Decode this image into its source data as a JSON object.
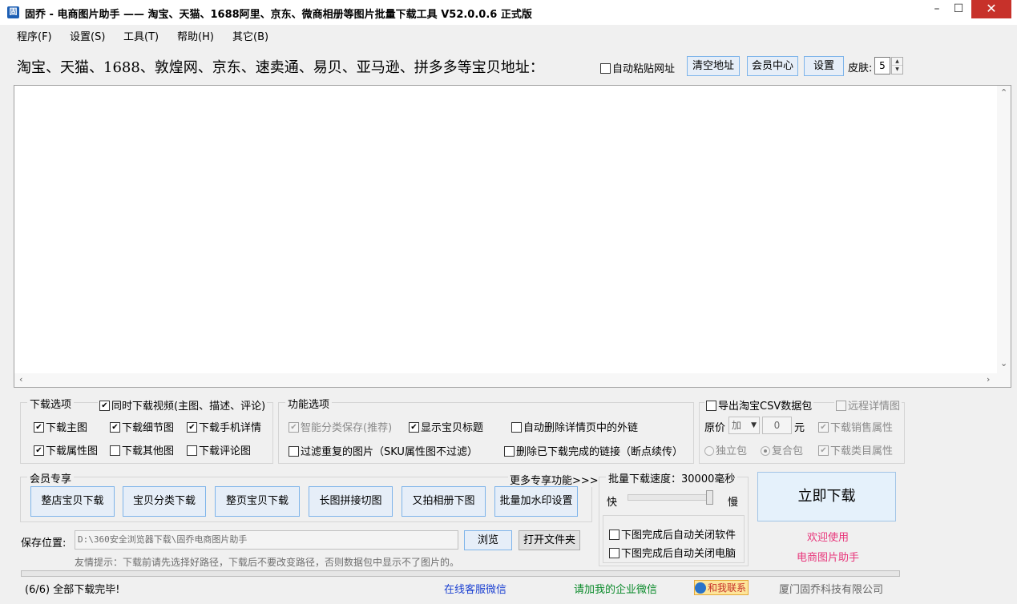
{
  "window": {
    "icon_glyph": "固",
    "title": "固乔 - 电商图片助手 —— 淘宝、天猫、1688阿里、京东、微商相册等图片批量下载工具 V52.0.0.6 正式版",
    "minimize": "–",
    "maximize": "☐",
    "close": "✕"
  },
  "menu": {
    "items": [
      "程序(F)",
      "设置(S)",
      "工具(T)",
      "帮助(H)",
      "其它(B)"
    ]
  },
  "url_row": {
    "label": "淘宝、天猫、1688、敦煌网、京东、速卖通、易贝、亚马逊、拼多多等宝贝地址：",
    "auto_paste": "自动粘贴网址",
    "clear_button": "清空地址",
    "member_button": "会员中心",
    "settings_button": "设置",
    "skin_label": "皮肤:",
    "skin_value": "5"
  },
  "textarea": {
    "value": ""
  },
  "download_options": {
    "title": "下载选项",
    "video": "同时下载视频(主图、描述、评论)",
    "main": "下载主图",
    "detail": "下载细节图",
    "mobile": "下载手机详情",
    "attr": "下载属性图",
    "other": "下载其他图",
    "review": "下载评论图"
  },
  "function_options": {
    "title": "功能选项",
    "smart_save": "智能分类保存(推荐)",
    "show_title": "显示宝贝标题",
    "remove_links": "自动删除详情页中的外链",
    "filter_dup": "过滤重复的图片（SKU属性图不过滤）",
    "delete_done": "删除已下载完成的链接（断点续传）"
  },
  "csv_options": {
    "export_csv": "导出淘宝CSV数据包",
    "remote_detail": "远程详情图",
    "price_label": "原价",
    "price_op": "加",
    "price_value": "0",
    "price_unit": "元",
    "sales_attr": "下载销售属性",
    "single_pack": "独立包",
    "combo_pack": "复合包",
    "category_attr": "下载类目属性"
  },
  "member": {
    "title": "会员专享",
    "more": "更多专享功能>>>",
    "buttons": [
      "整店宝贝下载",
      "宝贝分类下载",
      "整页宝贝下载",
      "长图拼接切图",
      "又拍相册下图",
      "批量加水印设置"
    ]
  },
  "speed": {
    "title": "批量下载速度：30000毫秒",
    "fast": "快",
    "slow": "慢",
    "level": 1.0,
    "close_app": "下图完成后自动关闭软件",
    "close_pc": "下图完成后自动关闭电脑"
  },
  "download_now": "立即下载",
  "welcome_line1": "欢迎使用",
  "welcome_line2": "电商图片助手",
  "save": {
    "label": "保存位置:",
    "path": "D:\\360安全浏览器下载\\固乔电商图片助手",
    "browse": "浏览",
    "open_folder": "打开文件夹",
    "hint": "友情提示：下载前请先选择好路径，下载后不要改变路径，否则数据包中显示不了图片的。"
  },
  "progress": {
    "fraction": 0
  },
  "status": {
    "done": "(6/6) 全部下载完毕!",
    "service": "在线客服微信",
    "wechat": "请加我的企业微信",
    "contact": "和我联系",
    "company": "厦门固乔科技有限公司"
  },
  "colors": {
    "accent_border": "#7eb4ea",
    "link_blue": "#1a3fd1",
    "link_green": "#0a8a2a",
    "pink": "#e8357a",
    "close_red": "#c7312a"
  }
}
